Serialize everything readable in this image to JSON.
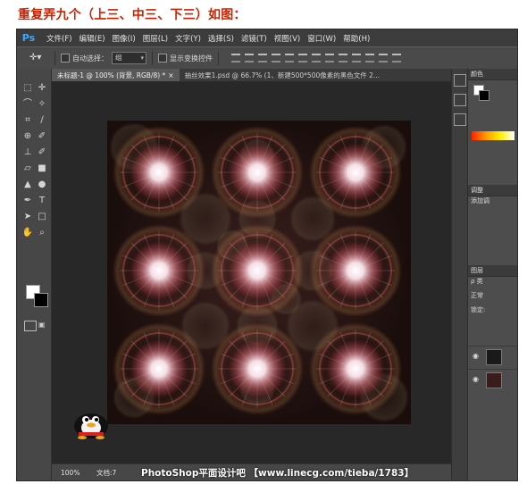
{
  "article": {
    "title": "重复弄九个（上三、中三、下三）如图："
  },
  "menubar": {
    "logo": "Ps",
    "items": [
      "文件(F)",
      "编辑(E)",
      "图像(I)",
      "图层(L)",
      "文字(Y)",
      "选择(S)",
      "滤镜(T)",
      "视图(V)",
      "窗口(W)",
      "帮助(H)"
    ]
  },
  "options": {
    "auto_select_label": "自动选择：",
    "auto_select_value": "组",
    "show_transform_label": "显示变换控件"
  },
  "tabs": [
    {
      "label": "未标题-1 @ 100% (背景, RGB/8) *",
      "close": "×"
    },
    {
      "label": "抽丝效果1.psd @ 66.7% (1、新建500*500像素的黑色文件 2...",
      "close": ""
    }
  ],
  "statusbar": {
    "zoom": "100%",
    "doc": "文档:7",
    "watermark": "PhotoShop平面设计吧  【www.linecg.com/tieba/1783】"
  },
  "right_panel": {
    "color_tab": "颜色",
    "adjust_tab": "调整",
    "adjust_add": "添加调",
    "layers_tab": "图层",
    "kind_label": "ρ 类",
    "mode_label": "正常",
    "lock_label": "锁定:"
  },
  "colors": {
    "menubar_bg": "#3c3c3c",
    "workspace_bg": "#282828",
    "title_color": "#cc2200",
    "glow_core": "#ffffff",
    "glow_halo": "#d65a5a"
  },
  "icons": {
    "tools": [
      "move-tool-icon",
      "artboard-icon",
      "marquee-tool-icon",
      "lasso-tool-icon",
      "quick-select-icon",
      "crop-tool-icon",
      "eyedropper-icon",
      "healing-brush-icon",
      "brush-tool-icon",
      "clone-stamp-icon",
      "history-brush-icon",
      "eraser-tool-icon",
      "gradient-tool-icon",
      "blur-tool-icon",
      "dodge-tool-icon",
      "pen-tool-icon",
      "type-tool-icon",
      "path-select-icon",
      "shape-tool-icon",
      "hand-tool-icon",
      "zoom-tool-icon"
    ]
  }
}
